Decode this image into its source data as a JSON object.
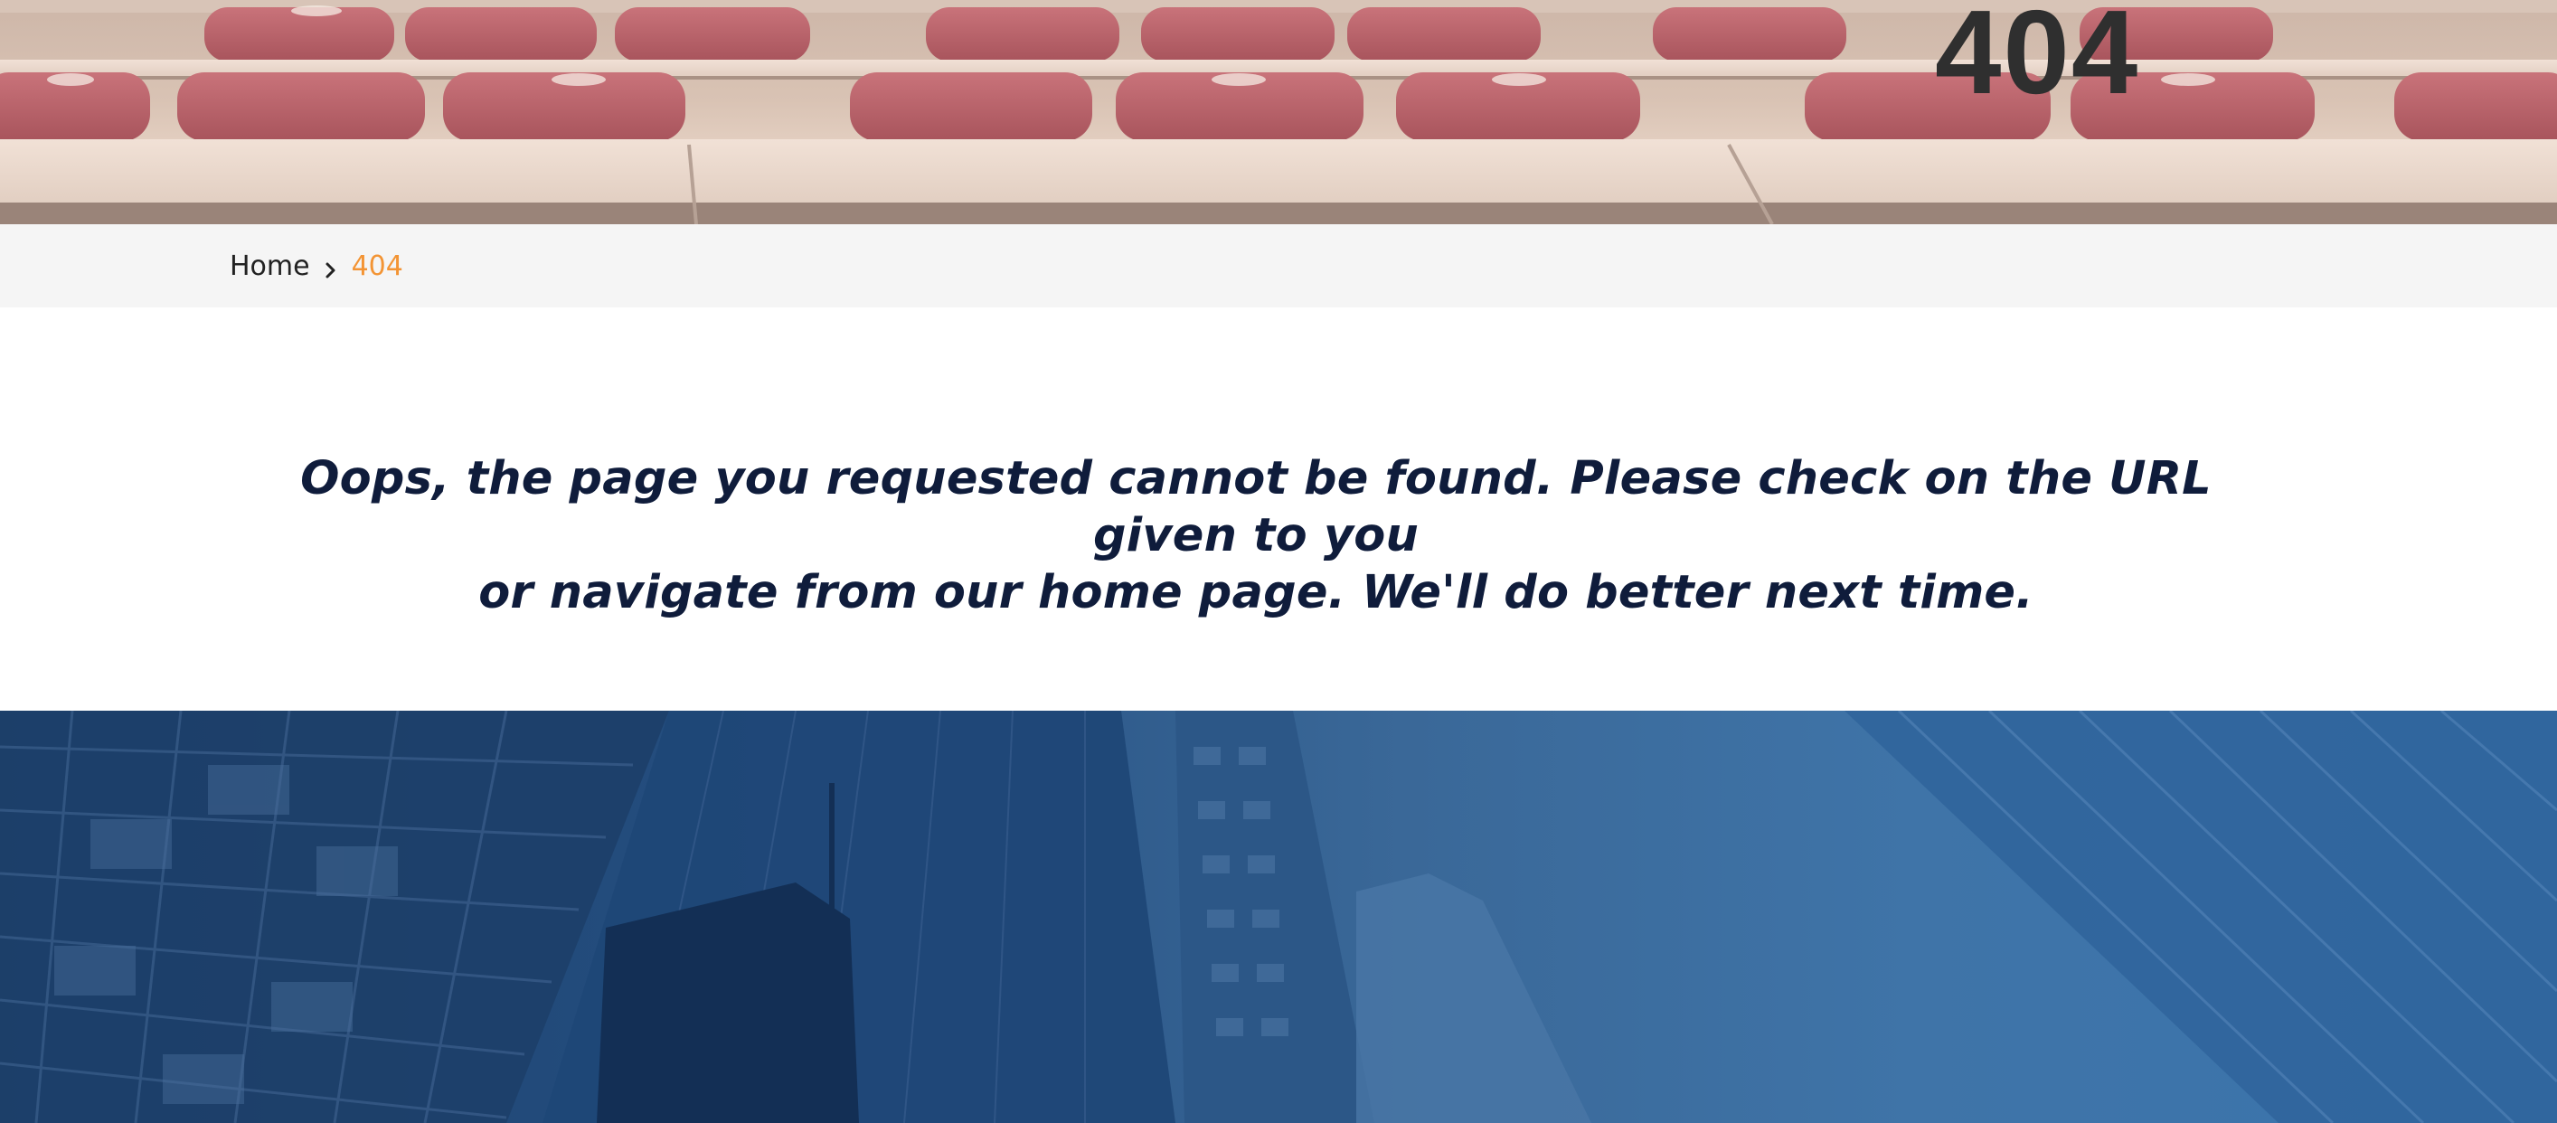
{
  "hero": {
    "title": "404",
    "image": "classroom-chairs-photo"
  },
  "breadcrumb": {
    "home_label": "Home",
    "separator_icon": "chevron-right-icon",
    "current_label": "404"
  },
  "message": {
    "line1": "Oops, the page you requested cannot be found. Please check on the URL given to you",
    "line2": "or navigate from our home page. We'll do better next time."
  },
  "footer": {
    "image": "city-buildings-photo"
  },
  "colors": {
    "accent": "#f39434",
    "text_dark": "#0f1c3b",
    "breadcrumb_bg": "#f5f5f5",
    "footer_blue": "#2b5888"
  }
}
